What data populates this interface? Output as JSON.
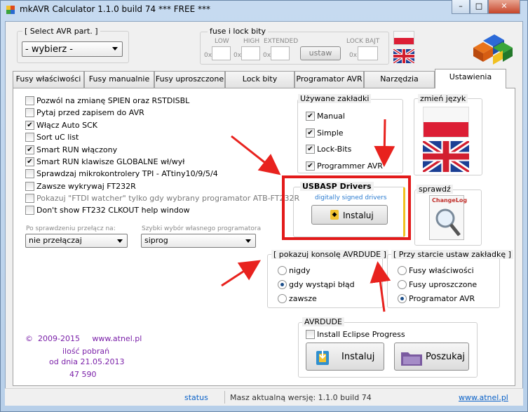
{
  "window": {
    "title": "mkAVR Calculator 1.1.0 build 74   *** FREE ***",
    "min_label": "–",
    "max_label": "□",
    "close_label": "✕"
  },
  "avr_select": {
    "legend": "[ Select AVR part. ]",
    "value": "- wybierz -"
  },
  "fuse": {
    "legend": "fuse i lock bity",
    "low": "LOW",
    "high": "HIGH",
    "extended": "EXTENDED",
    "lock_bajt": "LOCK BAJT",
    "prefix": "0x",
    "set_button": "ustaw"
  },
  "tabs": [
    {
      "label": "Fusy właściwości"
    },
    {
      "label": "Fusy manualnie"
    },
    {
      "label": "Fusy uproszczone"
    },
    {
      "label": "Lock bity"
    },
    {
      "label": "Programator AVR"
    },
    {
      "label": "Narzędzia"
    },
    {
      "label": "Ustawienia"
    }
  ],
  "options": [
    {
      "label": "Pozwól na zmianę SPIEN oraz RSTDISBL",
      "checked": false
    },
    {
      "label": "Pytaj przed zapisem do AVR",
      "checked": false
    },
    {
      "label": "Włącz Auto SCK",
      "checked": true
    },
    {
      "label": "Sort uC list",
      "checked": false
    },
    {
      "label": "Smart RUN włączony",
      "checked": true
    },
    {
      "label": "Smart RUN klawisze GLOBALNE wł/wył",
      "checked": true
    },
    {
      "label": "Sprawdzaj mikrokontrolery TPI - ATtiny10/9/5/4",
      "checked": false
    },
    {
      "label": "Zawsze wykrywaj FT232R",
      "checked": false
    },
    {
      "label": "Pokazuj \"FTDI watcher\" tylko gdy wybrany programator ATB-FT232R",
      "checked": false
    },
    {
      "label": "Don't show FT232 CLKOUT help window",
      "checked": false
    }
  ],
  "after_check": {
    "label": "Po sprawdzeniu przełącz na:",
    "value": "nie przełączaj"
  },
  "programmer_pick": {
    "label": "Szybki wybór własnego programatora",
    "value": "siprog"
  },
  "used_tabs": {
    "legend": "Używane zakładki",
    "items": [
      {
        "label": "Manual",
        "checked": true
      },
      {
        "label": "Simple",
        "checked": true
      },
      {
        "label": "Lock-Bits",
        "checked": true
      },
      {
        "label": "Programmer AVR",
        "checked": true
      }
    ]
  },
  "language": {
    "legend": "zmień język"
  },
  "usbasp": {
    "title": "USBASP Drivers",
    "subtitle": "digitally signed drivers",
    "button": "Instaluj"
  },
  "check": {
    "legend": "sprawdź",
    "icon_text": "ChangeLog"
  },
  "console": {
    "legend": "[ pokazuj konsolę AVRDUDE ]",
    "items": [
      {
        "label": "nigdy",
        "selected": false
      },
      {
        "label": "gdy wystąpi błąd",
        "selected": true
      },
      {
        "label": "zawsze",
        "selected": false
      }
    ]
  },
  "startup_tab": {
    "legend": "[ Przy starcie ustaw zakładkę ]",
    "items": [
      {
        "label": "Fusy właściwości",
        "selected": false
      },
      {
        "label": "Fusy uproszczone",
        "selected": false
      },
      {
        "label": "Programator AVR",
        "selected": true
      }
    ]
  },
  "avrdude": {
    "legend": "AVRDUDE",
    "eclipse_label": "Install Eclipse Progress",
    "install_button": "Instaluj",
    "search_button": "Poszukaj"
  },
  "footer": {
    "copyright": "©  2009-2015     www.atnel.pl",
    "downloads_label": "ilość pobrań",
    "downloads_since": "od dnia 21.05.2013",
    "downloads_count": "47 590"
  },
  "statusbar": {
    "status": "status",
    "version": "Masz aktualną wersję: 1.1.0 build 74",
    "link": "www.atnel.pl"
  },
  "colors": {
    "arrow": "#e8221e",
    "highlight_box": "#e31a1a",
    "purple_text": "#7a1fa8"
  }
}
